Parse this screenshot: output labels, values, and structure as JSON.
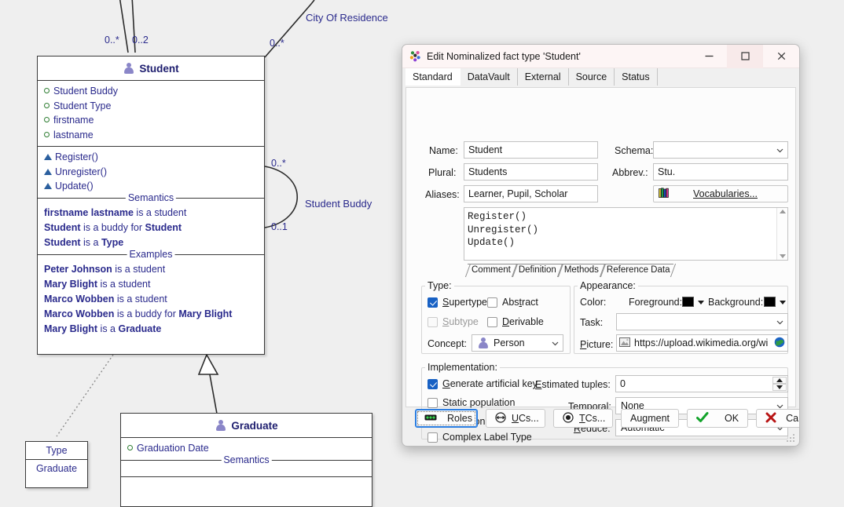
{
  "diagram": {
    "edge_labels": [
      {
        "text": "City Of Residence"
      },
      {
        "text": "Student Buddy"
      }
    ],
    "multiplicities": [
      "0..*",
      "0..2",
      "0..*",
      "0..*",
      "0..1"
    ],
    "student_class": {
      "title": "Student",
      "icon": "person-icon",
      "attributes": [
        "Student Buddy",
        "Student Type",
        "firstname",
        "lastname"
      ],
      "methods": [
        "Register()",
        "Unregister()",
        "Update()"
      ],
      "semantics_caption": "Semantics",
      "semantics": [
        [
          {
            "t": "firstname lastname",
            "b": true
          },
          {
            "t": " is a student",
            "b": false
          }
        ],
        [
          {
            "t": "Student",
            "b": true
          },
          {
            "t": " is a buddy for ",
            "b": false
          },
          {
            "t": "Student",
            "b": true
          }
        ],
        [
          {
            "t": "Student",
            "b": true
          },
          {
            "t": " is a ",
            "b": false
          },
          {
            "t": "Type",
            "b": true
          }
        ]
      ],
      "examples_caption": "Examples",
      "examples": [
        [
          {
            "t": "Peter Johnson",
            "b": true
          },
          {
            "t": " is a student",
            "b": false
          }
        ],
        [
          {
            "t": "Mary Blight",
            "b": true
          },
          {
            "t": " is a student",
            "b": false
          }
        ],
        [
          {
            "t": "Marco Wobben",
            "b": true
          },
          {
            "t": " is a student",
            "b": false
          }
        ],
        [
          {
            "t": "Marco Wobben",
            "b": true
          },
          {
            "t": " is a buddy for ",
            "b": false
          },
          {
            "t": "Mary Blight",
            "b": true
          }
        ],
        [
          {
            "t": "Mary Blight",
            "b": true
          },
          {
            "t": " is a ",
            "b": false
          },
          {
            "t": "Graduate",
            "b": true
          }
        ]
      ]
    },
    "graduate_class": {
      "title": "Graduate",
      "icon": "person-icon",
      "attributes": [
        "Graduation Date"
      ],
      "semantics_caption": "Semantics"
    },
    "type_box": {
      "header": "Type",
      "row": "Graduate"
    }
  },
  "dialog": {
    "title": "Edit Nominalized fact type 'Student'",
    "title_icon": "flower-icon",
    "window_buttons": {
      "minimize": "minimize-icon",
      "maximize": "maximize-icon",
      "close": "close-icon"
    },
    "tabs": [
      {
        "label": "Standard",
        "selected": true
      },
      {
        "label": "DataVault",
        "selected": false
      },
      {
        "label": "External",
        "selected": false
      },
      {
        "label": "Source",
        "selected": false
      },
      {
        "label": "Status",
        "selected": false
      }
    ],
    "fields": {
      "name_label": "Name:",
      "name_value": "Student",
      "plural_label": "Plural:",
      "plural_value": "Students",
      "aliases_label": "Aliases:",
      "aliases_value": "Learner, Pupil, Scholar",
      "schema_label": "Schema:",
      "schema_value": "",
      "abbrev_label": "Abbrev.:",
      "abbrev_value": "Stu.",
      "vocabularies_label": "Vocabularies...",
      "vocabularies_icon": "books-icon"
    },
    "memo": {
      "lines": [
        "Register()",
        "Unregister()",
        "Update()"
      ],
      "tabs": [
        "Comment",
        "Definition",
        "Methods",
        "Reference Data"
      ]
    },
    "type_group": {
      "legend": "Type:",
      "checkboxes": [
        {
          "label": "Supertype",
          "checked": true,
          "disabled": false,
          "mnemonic": "S"
        },
        {
          "label": "Abstract",
          "checked": false,
          "disabled": false,
          "mnemonic": "t"
        },
        {
          "label": "Subtype",
          "checked": false,
          "disabled": true,
          "mnemonic": "S"
        },
        {
          "label": "Derivable",
          "checked": false,
          "disabled": false,
          "mnemonic": "D"
        }
      ],
      "concept_label": "Concept:",
      "concept_value": "Person",
      "concept_icon": "person-icon"
    },
    "appearance_group": {
      "legend": "Appearance:",
      "color_label": "Color:",
      "foreground_label": "Foreground:",
      "foreground_color": "#000000",
      "background_label": "Background:",
      "background_color": "#000000",
      "task_label": "Task:",
      "task_value": "",
      "picture_label": "Picture:",
      "picture_value": "https://upload.wikimedia.org/wi",
      "picture_icon": "image-icon",
      "picture_end_icon": "globe-icon"
    },
    "implementation_group": {
      "legend": "Implementation:",
      "checkboxes": [
        {
          "label": "Generate artificial key",
          "checked": true
        },
        {
          "label": "Static population",
          "checked": false
        },
        {
          "label": "Transitional",
          "checked": false
        },
        {
          "label": "Complex Label Type",
          "checked": false
        }
      ],
      "estimated_tuples_label": "Estimated tuples:",
      "estimated_tuples_value": "0",
      "temporal_label": "Temporal:",
      "temporal_value": "None",
      "reduce_label": "Reduce:",
      "reduce_value": "Automatic"
    },
    "buttons": [
      {
        "label": "Roles",
        "icon": "roles-icon",
        "focused": true
      },
      {
        "label": "UCs...",
        "icon": "uc-icon",
        "focused": false
      },
      {
        "label": "TCs...",
        "icon": "tc-icon",
        "focused": false
      },
      {
        "label": "Augment",
        "icon": "",
        "focused": false
      },
      {
        "label": "OK",
        "icon": "check-icon",
        "focused": false
      },
      {
        "label": "Cancel",
        "icon": "cross-icon",
        "focused": false
      }
    ]
  }
}
